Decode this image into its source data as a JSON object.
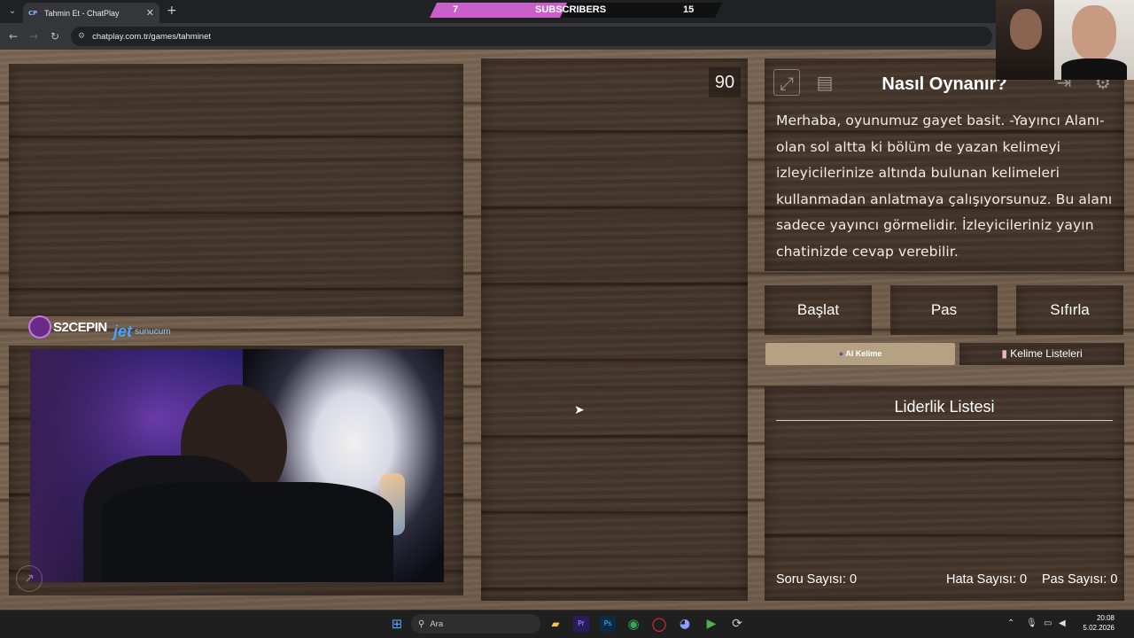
{
  "browser": {
    "tab_title": "Tahmin Et - ChatPlay",
    "tab_favicon": "CP",
    "url": "chatplay.com.tr/games/tahminet"
  },
  "subscribers_bar": {
    "left_count": "7",
    "label": "SUBSCRIBERS",
    "right_count": "15",
    "progress_fraction": 0.47,
    "fill_color": "#c95fc9"
  },
  "sponsors": {
    "first": "S2CEPIN",
    "second_name": "jet",
    "second_suffix": "sunucum"
  },
  "game": {
    "timer": "90",
    "how_to_play": {
      "title": "Nasıl Oynanır?",
      "text": "Merhaba, oyunumuz gayet basit. -Yayıncı Alanı- olan sol altta ki bölüm de yazan kelimeyi izleyicilerinize altında bulunan kelimeleri kullanmadan anlatmaya çalışıyorsunuz. Bu alanı sadece yayıncı görmelidir. İzleyicileriniz yayın chatinizde cevap verebilir."
    },
    "buttons": {
      "start": "Başlat",
      "pass": "Pas",
      "reset": "Sıfırla",
      "ai_word": "AI Kelime",
      "word_lists": "Kelime Listeleri"
    },
    "leaderboard": {
      "title": "Liderlik Listesi",
      "question_count_label": "Soru Sayısı: 0",
      "error_count_label": "Hata Sayısı: 0",
      "pass_count_label": "Pas Sayısı: 0"
    }
  },
  "taskbar": {
    "search_placeholder": "Ara",
    "time": "20:08",
    "date": "5.02.2026"
  },
  "icons": [
    "fullscreen-icon",
    "rules-book-icon",
    "exit-icon",
    "settings-gear-icon",
    "windows-start-icon",
    "search-icon",
    "chrome-icon",
    "opera-icon",
    "discord-icon",
    "file-explorer-icon"
  ],
  "colors": {
    "wood": "#76614f",
    "panel": "#3c2d23",
    "ai_button": "#b6a185",
    "subscriber_pink": "#c95fc9"
  }
}
